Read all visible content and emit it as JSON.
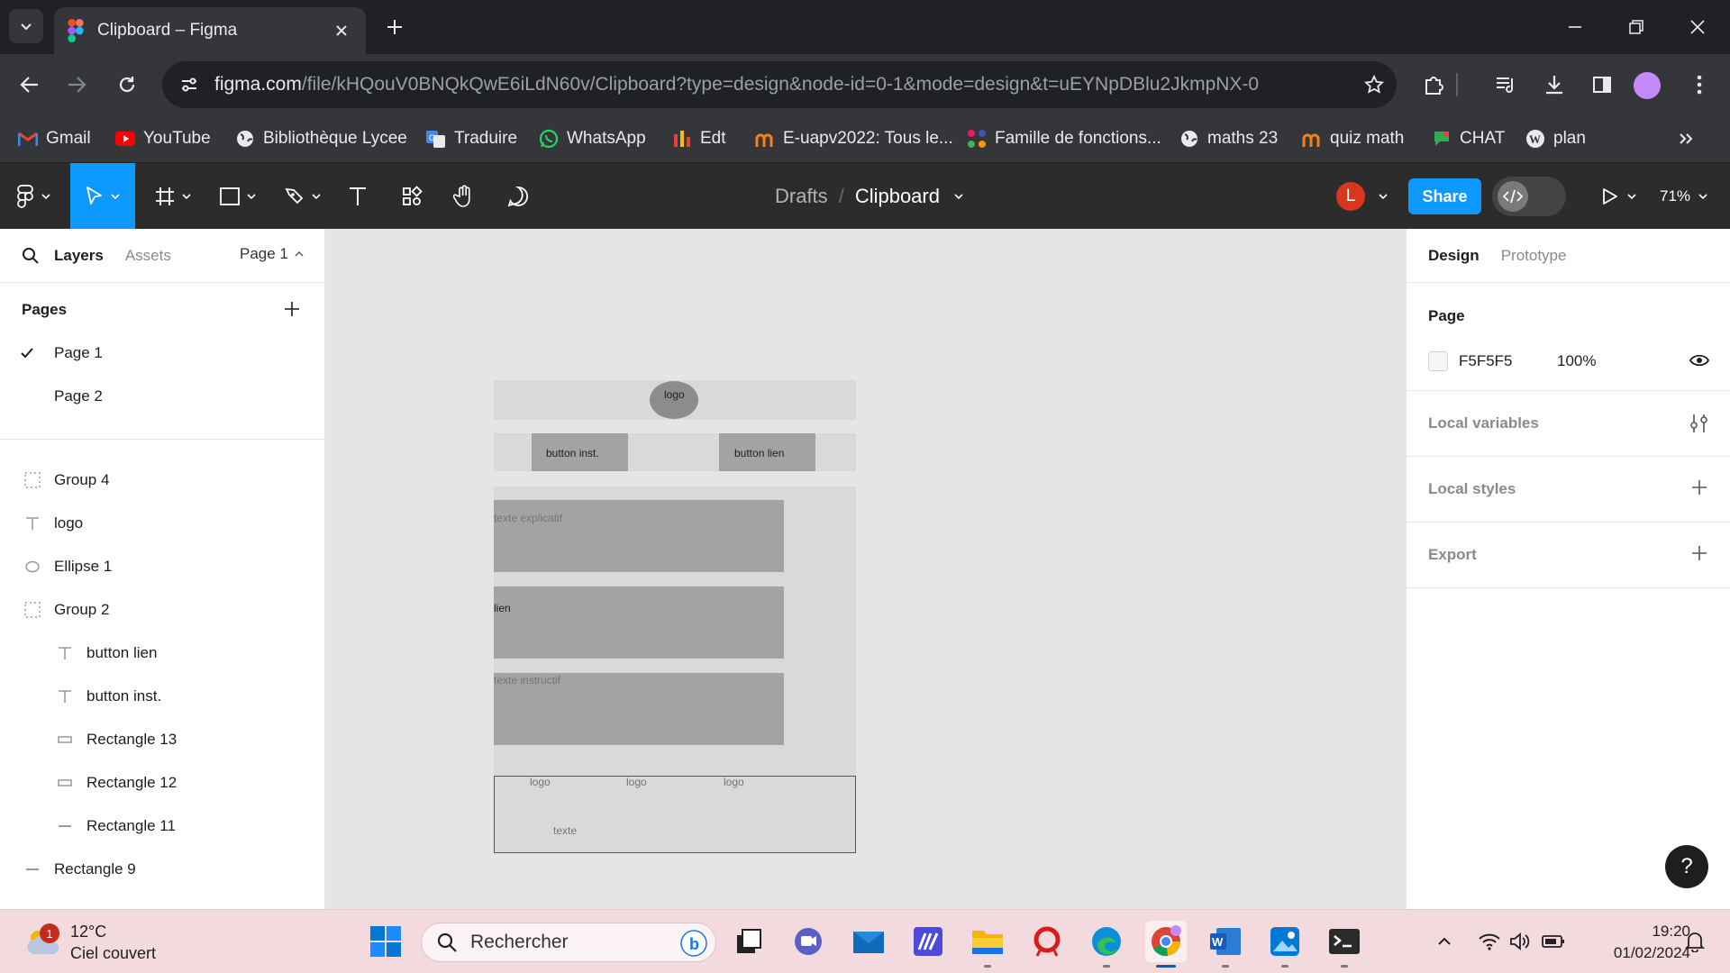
{
  "browser": {
    "tab_title": "Clipboard – Figma",
    "url_host": "figma.com",
    "url_path": "/file/kHQouV0BNQkQwE6iLdN60v/Clipboard?type=design&node-id=0-1&mode=design&t=uEYNpDBlu2JkmpNX-0",
    "bookmarks": [
      {
        "label": "Gmail",
        "icon": "gmail-icon"
      },
      {
        "label": "YouTube",
        "icon": "youtube-icon"
      },
      {
        "label": "Bibliothèque Lycee",
        "icon": "globe-icon"
      },
      {
        "label": "Traduire",
        "icon": "translate-icon"
      },
      {
        "label": "WhatsApp",
        "icon": "whatsapp-icon"
      },
      {
        "label": "Edt",
        "icon": "bars-icon"
      },
      {
        "label": "E-uapv2022: Tous le...",
        "icon": "moodle-icon"
      },
      {
        "label": "Famille de fonctions...",
        "icon": "dots-icon"
      },
      {
        "label": "maths 23",
        "icon": "globe-icon"
      },
      {
        "label": "quiz math",
        "icon": "moodle-icon"
      },
      {
        "label": "CHAT",
        "icon": "chat-icon"
      },
      {
        "label": "plan",
        "icon": "wordpress-icon"
      }
    ]
  },
  "figma": {
    "breadcrumb_drafts": "Drafts",
    "breadcrumb_sep": "/",
    "file_name": "Clipboard",
    "avatar_initial": "L",
    "share_label": "Share",
    "zoom": "71%",
    "left_tabs": {
      "layers": "Layers",
      "assets": "Assets",
      "page_selector": "Page 1"
    },
    "pages_header": "Pages",
    "pages": [
      "Page 1",
      "Page 2"
    ],
    "layers": [
      {
        "name": "Group 4",
        "type": "group",
        "indent": 0
      },
      {
        "name": "logo",
        "type": "text",
        "indent": 0
      },
      {
        "name": "Ellipse 1",
        "type": "ellipse",
        "indent": 0
      },
      {
        "name": "Group 2",
        "type": "group",
        "indent": 0
      },
      {
        "name": "button lien",
        "type": "text",
        "indent": 1
      },
      {
        "name": "button inst.",
        "type": "text",
        "indent": 1
      },
      {
        "name": "Rectangle 13",
        "type": "rect",
        "indent": 1
      },
      {
        "name": "Rectangle 12",
        "type": "rect",
        "indent": 1
      },
      {
        "name": "Rectangle 11",
        "type": "line",
        "indent": 1
      },
      {
        "name": "Rectangle 9",
        "type": "line",
        "indent": 0
      }
    ],
    "right_tabs": {
      "design": "Design",
      "prototype": "Prototype"
    },
    "page_section": {
      "title": "Page",
      "color_hex": "F5F5F5",
      "opacity": "100%"
    },
    "sections": [
      "Local variables",
      "Local styles",
      "Export"
    ],
    "help": "?",
    "canvas": {
      "header_logo": "logo",
      "button_inst": "button inst.",
      "button_lien": "button lien",
      "box1": "texte explicatif",
      "box2": "lien",
      "box3": "texte instructif",
      "footer_logo1": "logo",
      "footer_logo2": "logo",
      "footer_logo3": "logo",
      "footer_text": "texte"
    }
  },
  "taskbar": {
    "temperature": "12°C",
    "weather": "Ciel couvert",
    "weather_badge": "1",
    "search_placeholder": "Rechercher",
    "time": "19:20",
    "date": "01/02/2024"
  }
}
